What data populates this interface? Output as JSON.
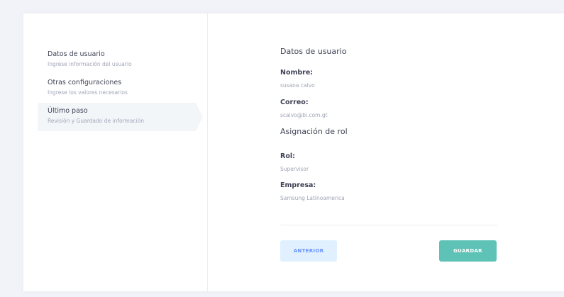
{
  "steps": [
    {
      "title": "Datos de usuario",
      "description": "Ingrese información del usuario"
    },
    {
      "title": "Otras configuraciones",
      "description": "Ingrese los valores necesarios"
    },
    {
      "title": "Último paso",
      "description": "Revisión y Guardado de información"
    }
  ],
  "summary": {
    "user_section": {
      "title": "Datos de usuario",
      "name_label": "Nombre:",
      "name_value": "susana calvo",
      "email_label": "Correo:",
      "email_value": "scalvo@bi.com.gt"
    },
    "role_section": {
      "title": "Asignación de rol",
      "role_label": "Rol:",
      "role_value": "Supervisor",
      "company_label": "Empresa:",
      "company_value": "Samsung Latinoamerica"
    }
  },
  "actions": {
    "previous_label": "ANTERIOR",
    "save_label": "GUARDAR"
  },
  "colors": {
    "accent_teal": "#5ec2b6",
    "prev_button_bg": "#e1f0ff",
    "prev_button_text": "#6993ff"
  }
}
